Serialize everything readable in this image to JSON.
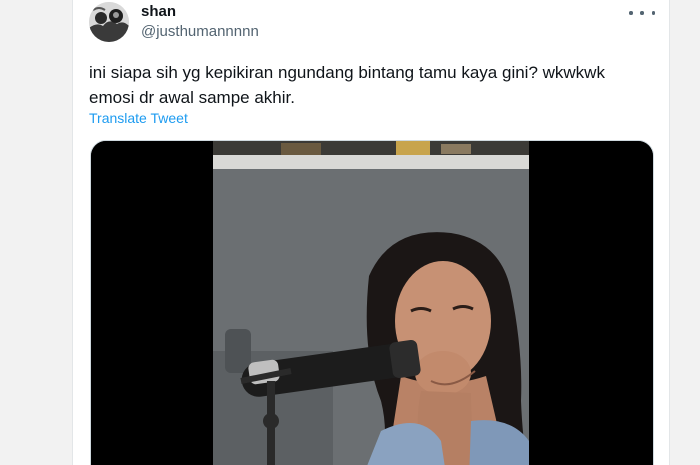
{
  "tweet": {
    "author_name": "shan",
    "author_handle": "@justhumannnnn",
    "text_lines": [
      "ini siapa sih yg kepikiran ngundang bintang tamu kaya gini? wkwkwk",
      "emosi dr awal sampe akhir."
    ],
    "translate_label": "Translate Tweet"
  },
  "icons": {
    "more": "more-horizontal-icon"
  },
  "colors": {
    "link": "#1d9bf0",
    "text_primary": "#0f1419",
    "text_secondary": "#536471",
    "media_background": "#000000"
  }
}
